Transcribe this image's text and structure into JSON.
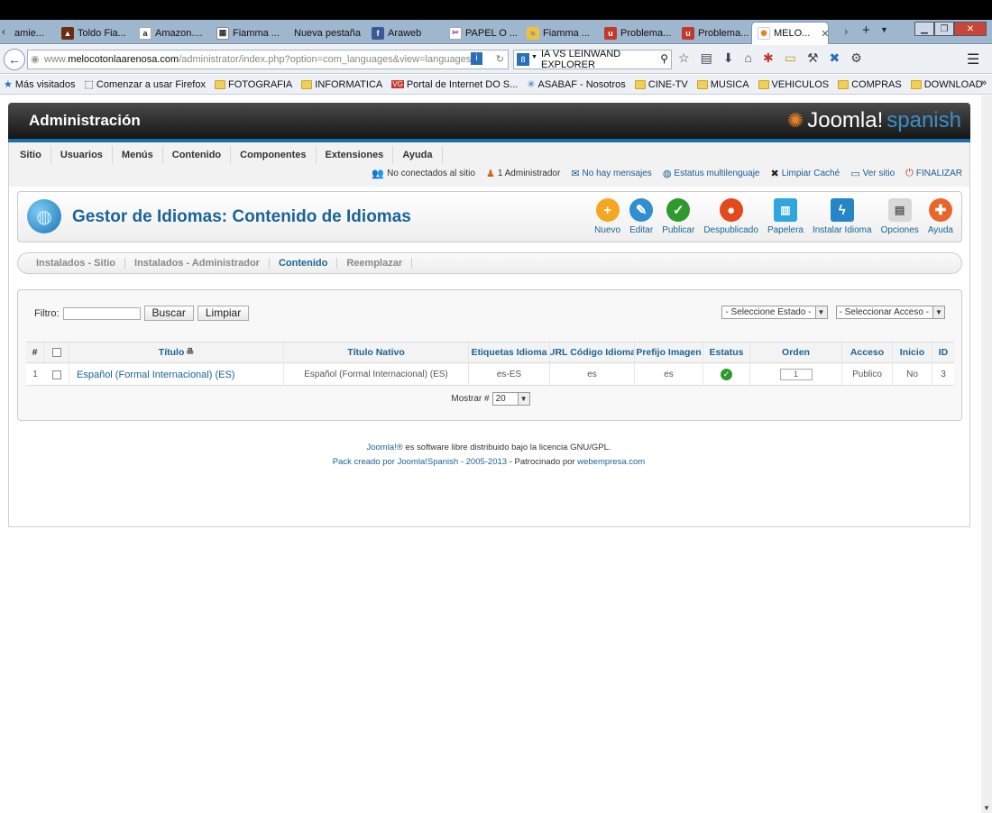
{
  "browser": {
    "tabs": [
      {
        "label": "amie...",
        "icon": "page-icon",
        "color": "#888888"
      },
      {
        "label": "Toldo Fia...",
        "icon": "fire-icon",
        "color": "#c0392b"
      },
      {
        "label": "Amazon....",
        "icon": "amazon-icon",
        "color": "#222222"
      },
      {
        "label": "Fiamma ...",
        "icon": "image-icon",
        "color": "#444444"
      },
      {
        "label": "Nueva pestaña",
        "icon": "",
        "color": ""
      },
      {
        "label": "Araweb",
        "icon": "facebook-icon",
        "color": "#3b5998"
      },
      {
        "label": "PAPEL O ...",
        "icon": "scissors-icon",
        "color": "#8e44ad"
      },
      {
        "label": "Fiamma ...",
        "icon": "beach-icon",
        "color": "#2e86c1"
      },
      {
        "label": "Problema...",
        "icon": "u-icon",
        "color": "#c0392b"
      },
      {
        "label": "Problema...",
        "icon": "u-icon",
        "color": "#c0392b"
      },
      {
        "label": "MELO...",
        "icon": "joomla-icon",
        "color": "#e67e22"
      }
    ],
    "url_domain": "www.melocotonlaarenosa.com",
    "url_prefix": "www.",
    "url_host": "melocotonlaarenosa.com",
    "url_path": "/administrator/index.php?option=com_languages&view=languages",
    "search_text": "IA VS LEINWAND EXPLORER",
    "bookmarks": [
      {
        "label": "Más visitados",
        "icon": "star-icon"
      },
      {
        "label": "Comenzar a usar Firefox",
        "icon": "page-icon"
      },
      {
        "label": "FOTOGRAFIA",
        "icon": "folder-icon"
      },
      {
        "label": "INFORMATICA",
        "icon": "folder-icon"
      },
      {
        "label": "Portal de Internet DO S...",
        "icon": "vg-icon"
      },
      {
        "label": "ASABAF - Nosotros",
        "icon": "snowflake-icon"
      },
      {
        "label": "CINE-TV",
        "icon": "folder-icon"
      },
      {
        "label": "MUSICA",
        "icon": "folder-icon"
      },
      {
        "label": "VEHICULOS",
        "icon": "folder-icon"
      },
      {
        "label": "COMPRAS",
        "icon": "folder-icon"
      },
      {
        "label": "DOWNLOAD",
        "icon": "folder-icon"
      }
    ]
  },
  "admin": {
    "title": "Administración",
    "logo_main": "Joomla!",
    "logo_suffix": "spanish",
    "menu": [
      "Sitio",
      "Usuarios",
      "Menús",
      "Contenido",
      "Componentes",
      "Extensiones",
      "Ayuda"
    ],
    "status": [
      {
        "label": "No conectados al sitio",
        "icon": "users-icon"
      },
      {
        "label": "1 Administrador",
        "icon": "user-icon"
      },
      {
        "label": "No hay mensajes",
        "icon": "mail-icon"
      },
      {
        "label": "Estatus multilenguaje",
        "icon": "globe-icon"
      },
      {
        "label": "Limpiar Caché",
        "icon": "joomla-icon"
      },
      {
        "label": "Ver sitio",
        "icon": "monitor-icon"
      },
      {
        "label": "FINALIZAR",
        "icon": "power-icon"
      }
    ]
  },
  "page": {
    "title": "Gestor de Idiomas: Contenido de Idiomas",
    "toolbar": [
      {
        "label": "Nuevo",
        "icon": "plus-icon",
        "color": "#f5a623",
        "glyph": "+"
      },
      {
        "label": "Editar",
        "icon": "pencil-icon",
        "color": "#2f8fd0",
        "glyph": "✎"
      },
      {
        "label": "Publicar",
        "icon": "check-icon",
        "color": "#2e9a2e",
        "glyph": "✓"
      },
      {
        "label": "Despublicado",
        "icon": "unpublish-icon",
        "color": "#e24a1c",
        "glyph": "●"
      },
      {
        "label": "Papelera",
        "icon": "trash-icon",
        "color": "#2fa6dc",
        "glyph": "🗑"
      },
      {
        "label": "Instalar Idioma",
        "icon": "install-icon",
        "color": "#2585c7",
        "glyph": "ϟ"
      },
      {
        "label": "Opciones",
        "icon": "options-icon",
        "color": "#9a9a9a",
        "glyph": "▤"
      },
      {
        "label": "Ayuda",
        "icon": "help-icon",
        "color": "#e9662b",
        "glyph": "✚"
      }
    ],
    "subtabs": [
      "Instalados - Sitio",
      "Instalados - Administrador",
      "Contenido",
      "Reemplazar"
    ],
    "active_subtab": "Contenido",
    "filter_label": "Filtro:",
    "filter_value": "",
    "search_button": "Buscar",
    "clear_button": "Limpiar",
    "state_select": "- Seleccione Estado -",
    "access_select": "- Seleccionar Acceso -",
    "columns": [
      "#",
      "",
      "Título",
      "Título Nativo",
      "Etiquetas Idioma",
      "URL Código Idioma",
      "Prefijo Imagen",
      "Estatus",
      "Orden",
      "Acceso",
      "Inicio",
      "ID"
    ],
    "rows": [
      {
        "num": "1",
        "title": "Español (Formal Internacional) (ES)",
        "native": "Español (Formal Internacional) (ES)",
        "tag": "es-ES",
        "url_code": "es",
        "prefix": "es",
        "status": "published",
        "order": "1",
        "access": "Publico",
        "home": "No",
        "id": "3"
      }
    ],
    "pager_label": "Mostrar #",
    "pager_value": "20"
  },
  "footer": {
    "line1_link": "Joomla!®",
    "line1_text": " es software libre distribuido bajo la licencia GNU/GPL.",
    "line2_link": "Pack creado por Joomla!Spanish - 2005-2013",
    "line2_text": " - Patrocinado por ",
    "line2_link2": "webempresa.com"
  }
}
